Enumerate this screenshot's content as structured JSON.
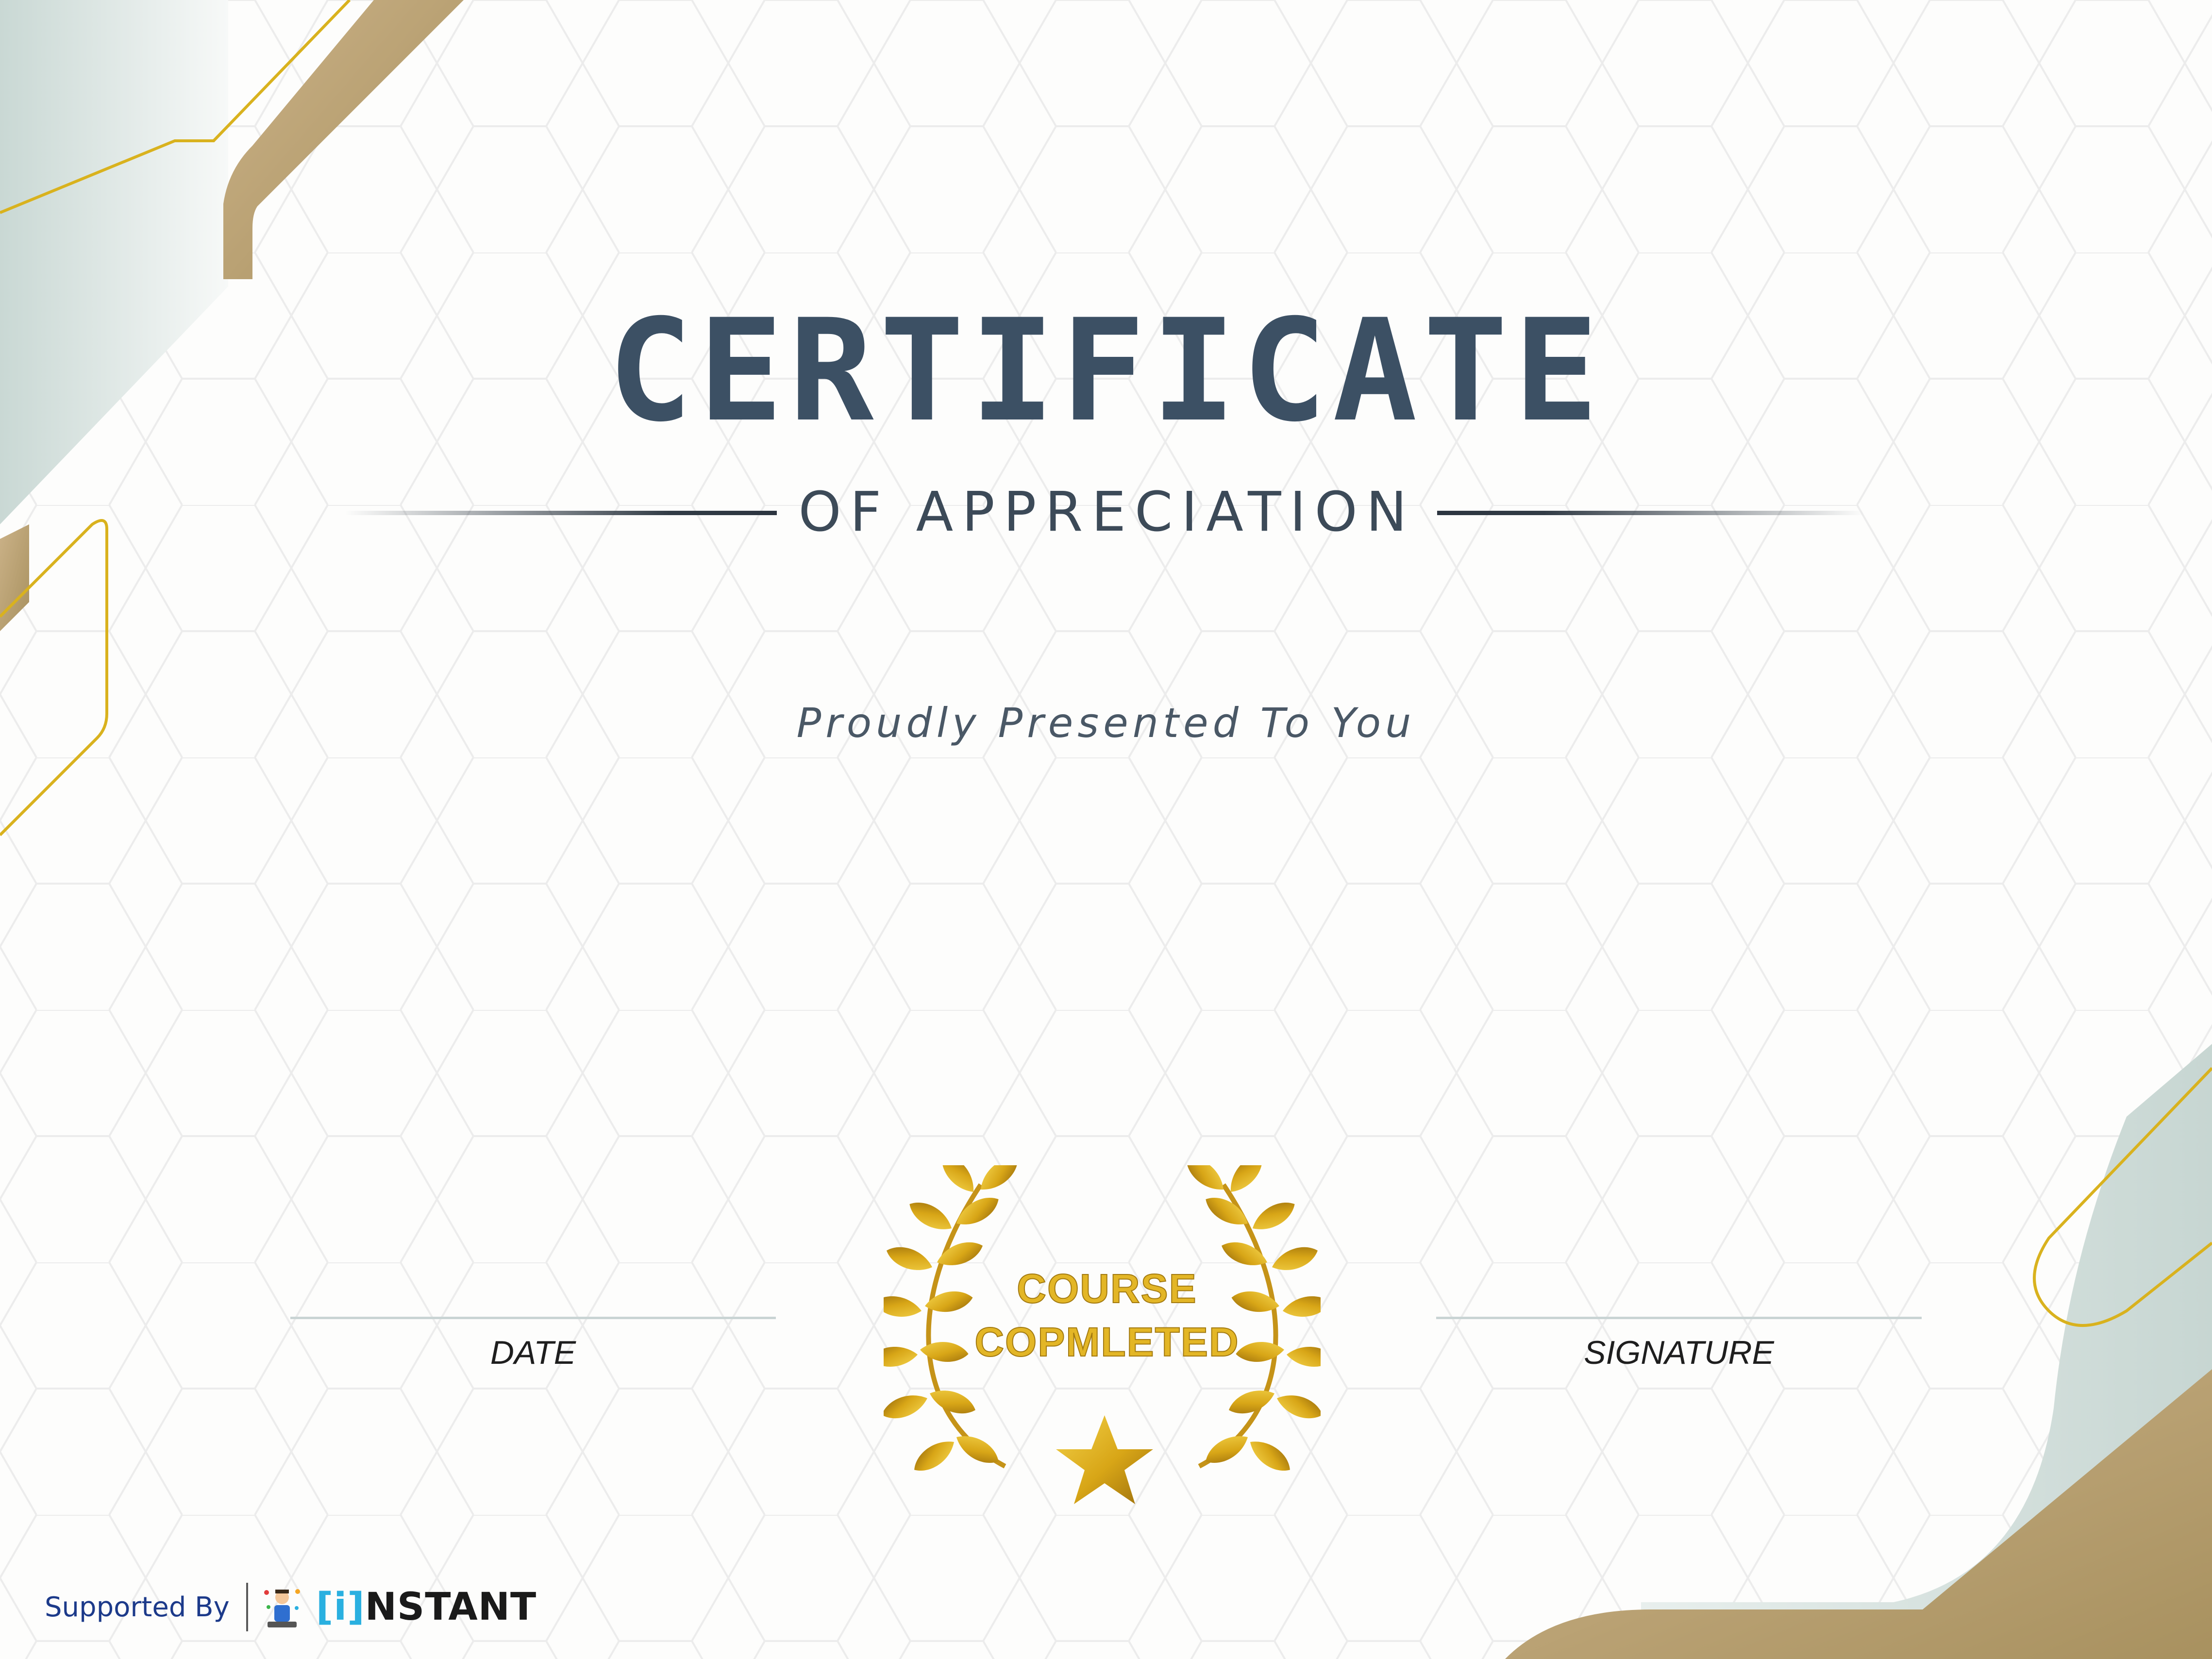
{
  "certificate": {
    "title": "CERTIFICATE",
    "subtitle": "OF APPRECIATION",
    "presented_line": "Proudly Presented To You"
  },
  "badge": {
    "line1": "COURSE",
    "line2": "COPMLETED"
  },
  "signatures": {
    "date_label": "DATE",
    "signature_label": "SIGNATURE"
  },
  "footer": {
    "supported_by": "Supported By",
    "brand_bracket": "[i]",
    "brand_rest": "NSTANT"
  },
  "colors": {
    "title": "#3c5064",
    "gold": "#c8a46a",
    "gold_line": "#d9b21e",
    "sage": "#cfdcd8",
    "badge_gold": "#e3b626"
  }
}
